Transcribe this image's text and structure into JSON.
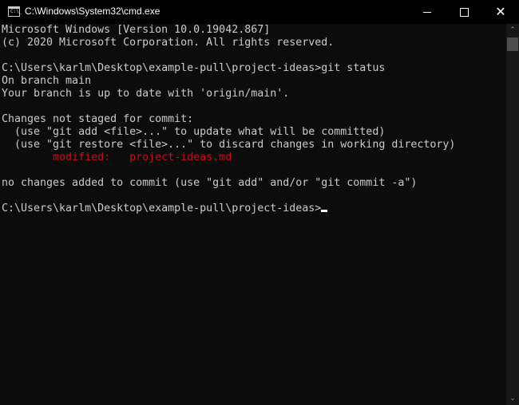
{
  "window": {
    "title": "C:\\Windows\\System32\\cmd.exe",
    "icon": "cmd-icon",
    "icon_text": "C:\\_",
    "minimize_glyph": "minimize-icon",
    "maximize_glyph": "maximize-icon",
    "close_glyph": "✕"
  },
  "console": {
    "lines": [
      {
        "text": "Microsoft Windows [Version 10.0.19042.867]"
      },
      {
        "text": "(c) 2020 Microsoft Corporation. All rights reserved."
      },
      {
        "text": ""
      },
      {
        "text": "C:\\Users\\karlm\\Desktop\\example-pull\\project-ideas>git status"
      },
      {
        "text": "On branch main"
      },
      {
        "text": "Your branch is up to date with 'origin/main'."
      },
      {
        "text": ""
      },
      {
        "text": "Changes not staged for commit:"
      },
      {
        "text": "  (use \"git add <file>...\" to update what will be committed)"
      },
      {
        "text": "  (use \"git restore <file>...\" to discard changes in working directory)"
      },
      {
        "text": "        modified:   project-ideas.md",
        "color": "red"
      },
      {
        "text": ""
      },
      {
        "text": "no changes added to commit (use \"git add\" and/or \"git commit -a\")"
      },
      {
        "text": ""
      }
    ],
    "prompt": "C:\\Users\\karlm\\Desktop\\example-pull\\project-ideas>",
    "text_color": "#cccccc",
    "error_color": "#c50f1f",
    "background": "#0c0c0c"
  },
  "scrollbar": {
    "up_arrow": "⌃",
    "down_arrow": "⌄"
  }
}
